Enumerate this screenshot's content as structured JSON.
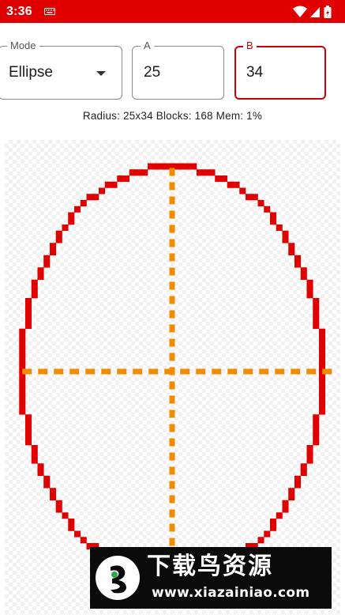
{
  "status_bar": {
    "time": "3:36",
    "icons": [
      "keyboard-icon",
      "wifi-icon",
      "signal-icon",
      "battery-icon"
    ]
  },
  "controls": {
    "mode": {
      "label": "Mode",
      "value": "Ellipse"
    },
    "a": {
      "label": "A",
      "value": "25"
    },
    "b": {
      "label": "B",
      "value": "34"
    }
  },
  "info_text": "Radius: 25x34 Blocks: 168 Mem: 1%",
  "shape": {
    "type": "ellipse",
    "radius_a": 25,
    "radius_b": 34,
    "blocks": 168
  },
  "colors": {
    "accent": "#e00000",
    "outline": "#e00000",
    "axis": "#f08c00",
    "checker": "#f1f1f1"
  },
  "watermark": {
    "title": "下载鸟资源",
    "url": "www.xiazainiao.com"
  }
}
